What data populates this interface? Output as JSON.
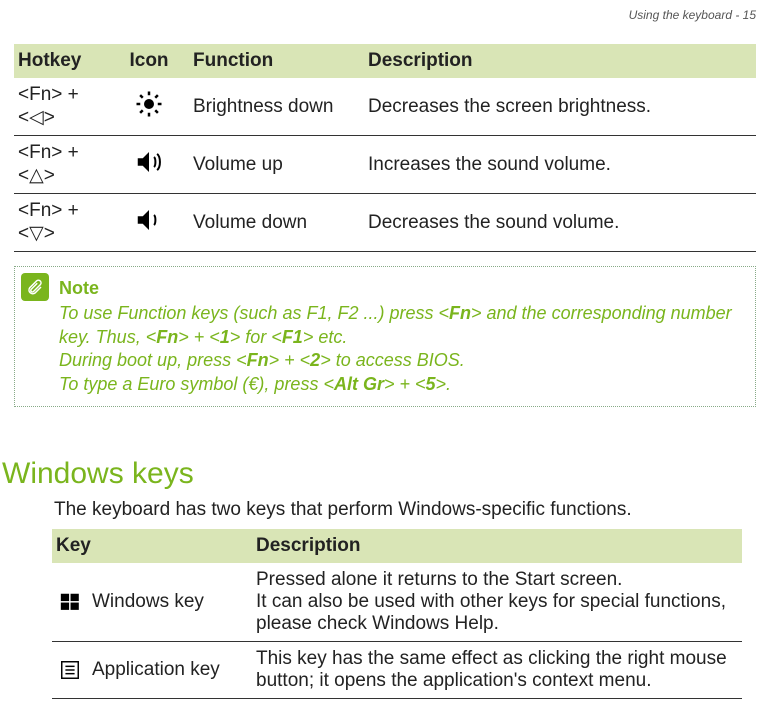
{
  "page_header": "Using the keyboard - 15",
  "hotkey_table": {
    "headers": {
      "hotkey": "Hotkey",
      "icon": "Icon",
      "function": "Function",
      "description": "Description"
    },
    "rows": [
      {
        "hotkey_prefix": "<Fn> +",
        "hotkey_suffix": "<◁>",
        "icon": "brightness-icon",
        "function": "Brightness down",
        "description": "Decreases the screen brightness."
      },
      {
        "hotkey_prefix": "<Fn> +",
        "hotkey_suffix": "<△>",
        "icon": "volume-up-icon",
        "function": "Volume up",
        "description": "Increases the sound volume."
      },
      {
        "hotkey_prefix": "<Fn> +",
        "hotkey_suffix": "<▽>",
        "icon": "volume-down-icon",
        "function": "Volume down",
        "description": "Decreases the sound volume."
      }
    ]
  },
  "note": {
    "title": "Note",
    "l1a": "To use Function keys (such as F1, F2 ...) press <",
    "l1b": "Fn",
    "l1c": "> and the corresponding number key. Thus, <",
    "l1d": "Fn",
    "l1e": "> + <",
    "l1f": "1",
    "l1g": "> for <",
    "l1h": "F1",
    "l1i": "> etc.",
    "l2a": "During boot up, press <",
    "l2b": "Fn",
    "l2c": "> + <",
    "l2d": "2",
    "l2e": "> to access BIOS.",
    "l3a": "To type a Euro symbol (€), press <",
    "l3b": "Alt Gr",
    "l3c": "> + <",
    "l3d": "5",
    "l3e": ">."
  },
  "section_heading": "Windows keys",
  "section_intro": "The keyboard has two keys that perform Windows-specific functions.",
  "win_table": {
    "headers": {
      "key": "Key",
      "description": "Description"
    },
    "rows": [
      {
        "icon": "windows-logo-icon",
        "key": "Windows key",
        "description": "Pressed alone it returns to the Start screen.\nIt can also be used with other keys for special functions, please check Windows Help."
      },
      {
        "icon": "application-key-icon",
        "key": "Application key",
        "description": "This key has the same effect as clicking the right mouse button; it opens the application's context menu."
      }
    ]
  }
}
